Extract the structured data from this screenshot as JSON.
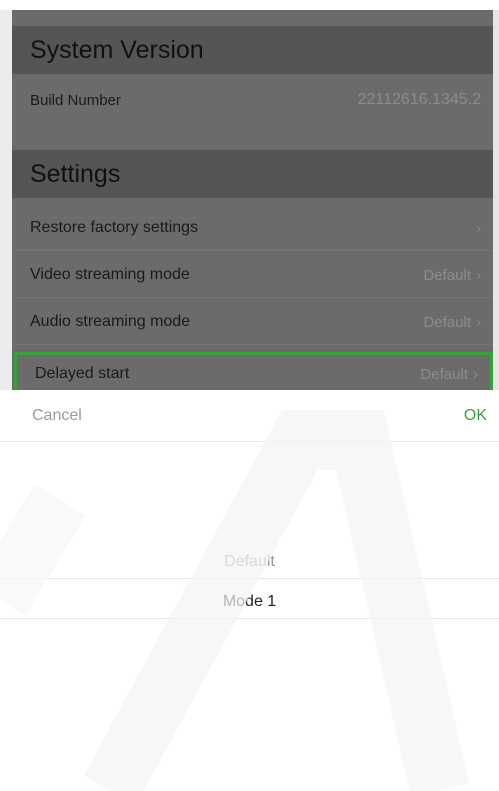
{
  "system_version": {
    "header": "System Version",
    "build_number_label": "Build Number",
    "build_number_value": "22112616.1345.2"
  },
  "settings": {
    "header": "Settings",
    "items": [
      {
        "label": "Restore factory settings",
        "value": ""
      },
      {
        "label": "Video streaming mode",
        "value": "Default"
      },
      {
        "label": "Audio streaming mode",
        "value": "Default"
      },
      {
        "label": "Delayed start",
        "value": "Default"
      }
    ]
  },
  "picker": {
    "cancel_label": "Cancel",
    "ok_label": "OK",
    "options": [
      "Default",
      "Mode 1"
    ],
    "selected": "Mode 1"
  },
  "icons": {
    "chevron": "chevron-right-icon"
  },
  "colors": {
    "accent": "#3aa33d",
    "highlight_border": "#35a23a",
    "dim_overlay": "#6b6b6b"
  }
}
